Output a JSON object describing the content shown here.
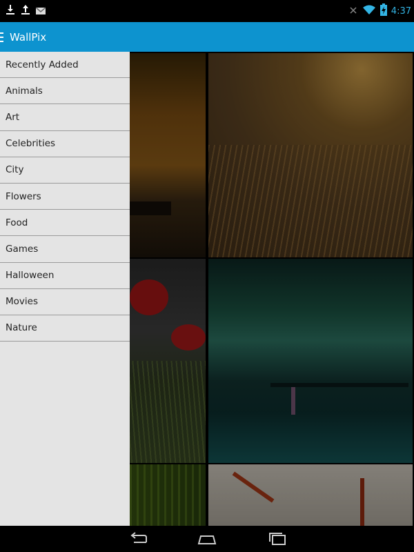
{
  "status_bar": {
    "time": "4:37",
    "left_icons": [
      "download-icon",
      "upload-icon",
      "gmail-icon"
    ],
    "right_icons": [
      "mute-icon",
      "wifi-icon",
      "battery-charging-icon"
    ]
  },
  "action_bar": {
    "title": "WallPix"
  },
  "drawer": {
    "items": [
      {
        "label": "Recently Added"
      },
      {
        "label": "Animals"
      },
      {
        "label": "Art"
      },
      {
        "label": "Celebrities"
      },
      {
        "label": "City"
      },
      {
        "label": "Flowers"
      },
      {
        "label": "Food"
      },
      {
        "label": "Games"
      },
      {
        "label": "Halloween"
      },
      {
        "label": "Movies"
      },
      {
        "label": "Nature"
      }
    ]
  },
  "wallpapers": [
    {
      "subject": "sunset-sea-ship"
    },
    {
      "subject": "golden-grass"
    },
    {
      "subject": "red-poppies"
    },
    {
      "subject": "aurora-lake"
    },
    {
      "subject": "green-forest"
    },
    {
      "subject": "red-grass-sky"
    }
  ],
  "nav_bar": {
    "buttons": [
      "back-icon",
      "home-icon",
      "recent-apps-icon"
    ]
  },
  "colors": {
    "action_bar": "#0d93cf",
    "status_time": "#33b5e5",
    "drawer_bg": "#e4e4e4"
  }
}
